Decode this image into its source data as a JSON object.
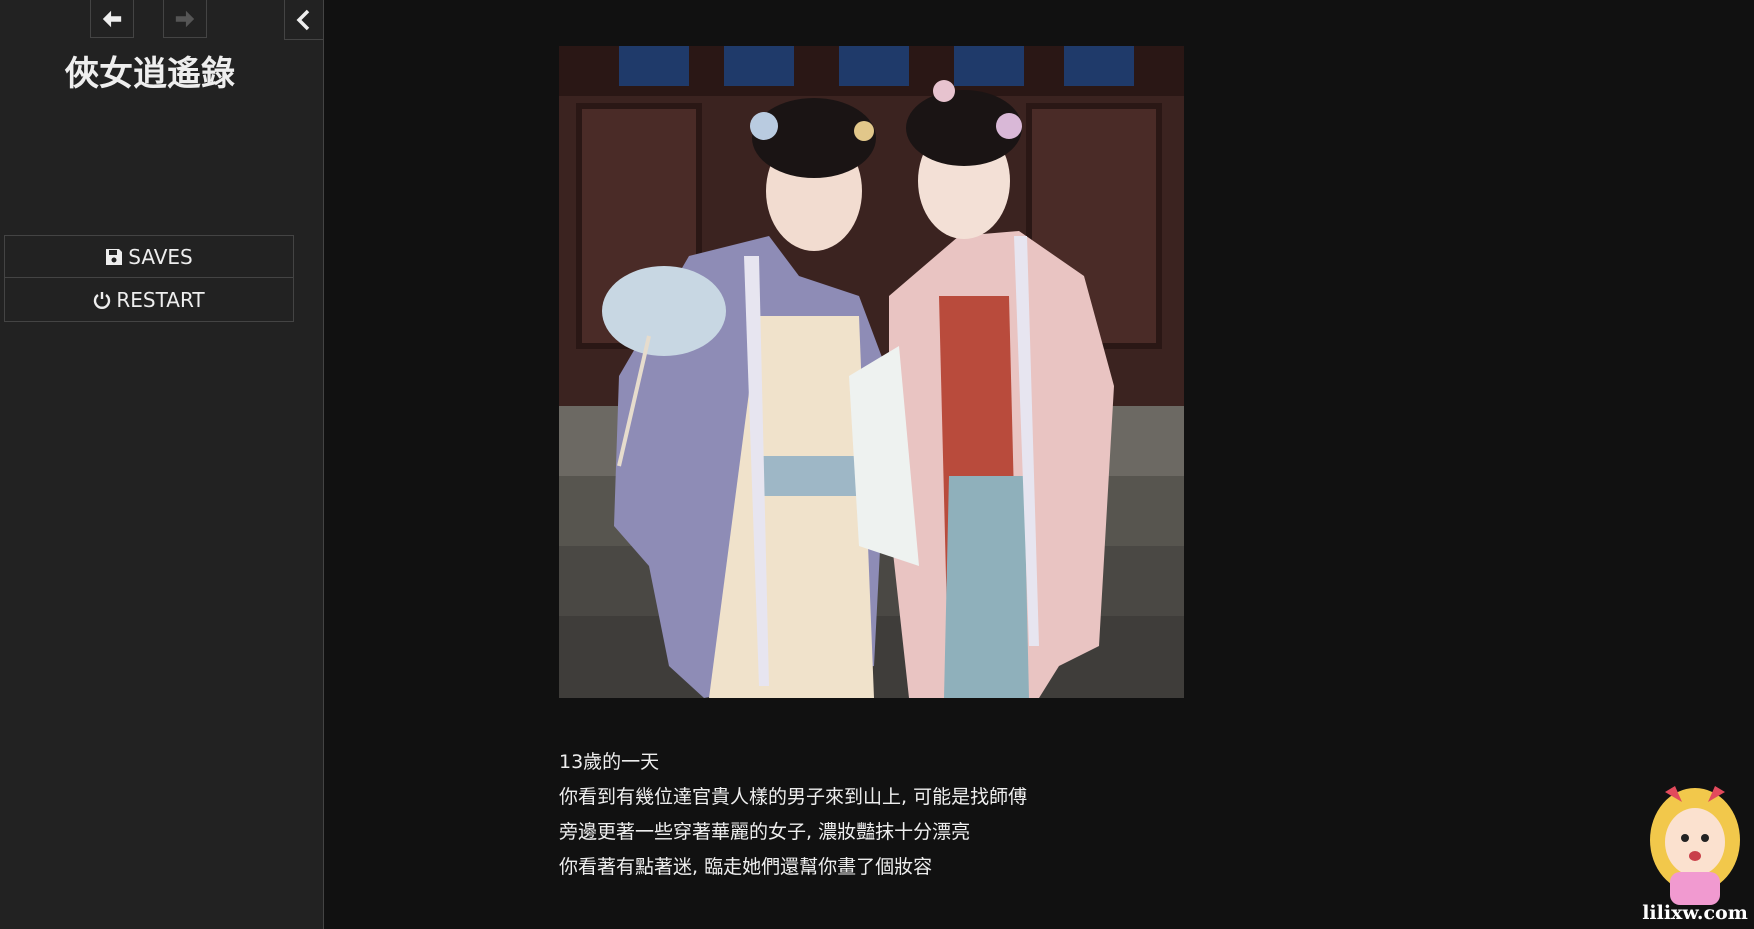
{
  "sidebar": {
    "back_icon": "arrow-left-icon",
    "forward_icon": "arrow-right-icon",
    "toggle_icon": "chevron-left-icon",
    "title": "俠女逍遙錄",
    "menu": [
      {
        "label": "SAVES",
        "icon": "floppy-disk-icon"
      },
      {
        "label": "RESTART",
        "icon": "power-icon"
      }
    ]
  },
  "passage": {
    "image": "photo of two women in hanfu",
    "lines": [
      "13歲的一天",
      "你看到有幾位達官貴人樣的男子來到山上, 可能是找師傅",
      "旁邊更著一些穿著華麗的女子, 濃妝豔抹十分漂亮",
      "你看著有點著迷, 臨走她們還幫你畫了個妝容"
    ]
  },
  "watermark": {
    "text": "lilixw.com"
  },
  "colors": {
    "background": "#111111",
    "sidebar": "#222222",
    "border": "#444444",
    "text": "#eeeeee"
  }
}
